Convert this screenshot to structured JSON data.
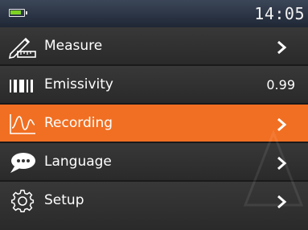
{
  "status": {
    "time": "14:05",
    "battery_level": 0.8,
    "battery_color": "#7ed321"
  },
  "menu": {
    "items": [
      {
        "label": "Measure",
        "icon": "ruler-pencil-icon",
        "trailing": "chevron"
      },
      {
        "label": "Emissivity",
        "icon": "barcode-icon",
        "trailing": "value",
        "value": "0.99"
      },
      {
        "label": "Recording",
        "icon": "waveform-icon",
        "trailing": "chevron",
        "selected": true
      },
      {
        "label": "Language",
        "icon": "chat-bubble-icon",
        "trailing": "chevron"
      },
      {
        "label": "Setup",
        "icon": "gear-icon",
        "trailing": "chevron"
      }
    ]
  },
  "colors": {
    "selection": "#f16f22",
    "row_background": "#333333",
    "header_background": "#2e3747"
  }
}
